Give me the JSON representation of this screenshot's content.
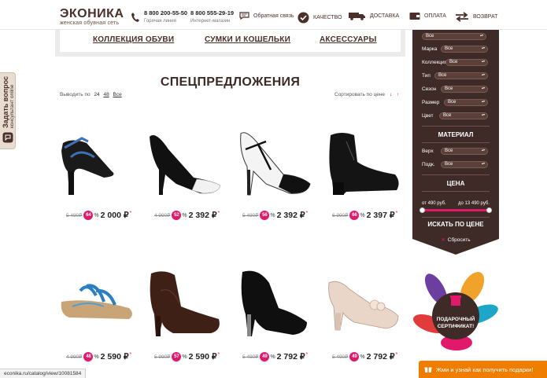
{
  "header": {
    "logo_name": "ЭКОНИКА",
    "logo_tagline": "женская обувная сеть",
    "phone1": "8 800 200-55-50",
    "phone1_label": "Горячая линия",
    "phone2": "8 800 555-29-19",
    "phone2_label": "Интернет-магазин",
    "feedback": "Обратная связь",
    "quality": "КАЧЕСТВО",
    "delivery": "ДОСТАВКА",
    "payment": "ОПЛАТА",
    "returns": "ВОЗВРАТ"
  },
  "nav": {
    "items": [
      "КОЛЛЕКЦИЯ ОБУВИ",
      "СУМКИ И КОШЕЛЬКИ",
      "АКСЕССУАРЫ"
    ]
  },
  "ask_tab": {
    "title": "Задать вопрос",
    "subtitle": "консультант online"
  },
  "page_title": "СПЕЦПРЕДЛОЖЕНИЯ",
  "toolbar": {
    "per_page_label": "Выводить по",
    "per_page_options": [
      "24",
      "48",
      "Все"
    ],
    "sort_label": "Сортировать по цене",
    "sort_down": "↓",
    "sort_up": "↑"
  },
  "products": [
    {
      "old": "5 490₽",
      "discount": "64",
      "pct": "%",
      "price": "2 000 ₽",
      "star": "*"
    },
    {
      "old": "4 990₽",
      "discount": "52",
      "pct": "%",
      "price": "2 392 ₽",
      "star": "*"
    },
    {
      "old": "5 490₽",
      "discount": "56",
      "pct": "%",
      "price": "2 392 ₽",
      "star": "*"
    },
    {
      "old": "6 990₽",
      "discount": "66",
      "pct": "%",
      "price": "2 397 ₽",
      "star": "*"
    },
    {
      "old": "4 990₽",
      "discount": "48",
      "pct": "%",
      "price": "2 590 ₽",
      "star": "*"
    },
    {
      "old": "5 990₽",
      "discount": "57",
      "pct": "%",
      "price": "2 590 ₽",
      "star": "*"
    },
    {
      "old": "5 490₽",
      "discount": "49",
      "pct": "%",
      "price": "2 792 ₽",
      "star": "*"
    },
    {
      "old": "5 490₽",
      "discount": "49",
      "pct": "%",
      "price": "2 792 ₽",
      "star": "*"
    }
  ],
  "filter": {
    "top_select": "Все",
    "rows": [
      {
        "label": "Марка",
        "value": "Все"
      },
      {
        "label": "Коллекция",
        "value": "Все"
      },
      {
        "label": "Тип",
        "value": "Все"
      },
      {
        "label": "Сезон",
        "value": "Все"
      },
      {
        "label": "Размер",
        "value": "Все"
      },
      {
        "label": "Цвет",
        "value": "Все"
      }
    ],
    "material_title": "МАТЕРИАЛ",
    "material_rows": [
      {
        "label": "Верх",
        "value": "Все"
      },
      {
        "label": "Подк.",
        "value": "Все"
      }
    ],
    "price_title": "ЦЕНА",
    "price_from": "от 490 руб.",
    "price_to": "до 13 490 руб.",
    "search_button": "ИСКАТЬ ПО ЦЕНЕ",
    "reset": "Сбросить"
  },
  "gift": {
    "line1": "ПОДАРОЧНЫЙ",
    "line2": "СЕРТИФИКАТ!"
  },
  "promo_bar": "Жми и узнай как получить подарки!",
  "status_url": "econika.ru/catalog/view/10081584",
  "colors": {
    "brand": "#4a2f2a",
    "accent": "#e0196b",
    "promo": "#ef7d00"
  }
}
